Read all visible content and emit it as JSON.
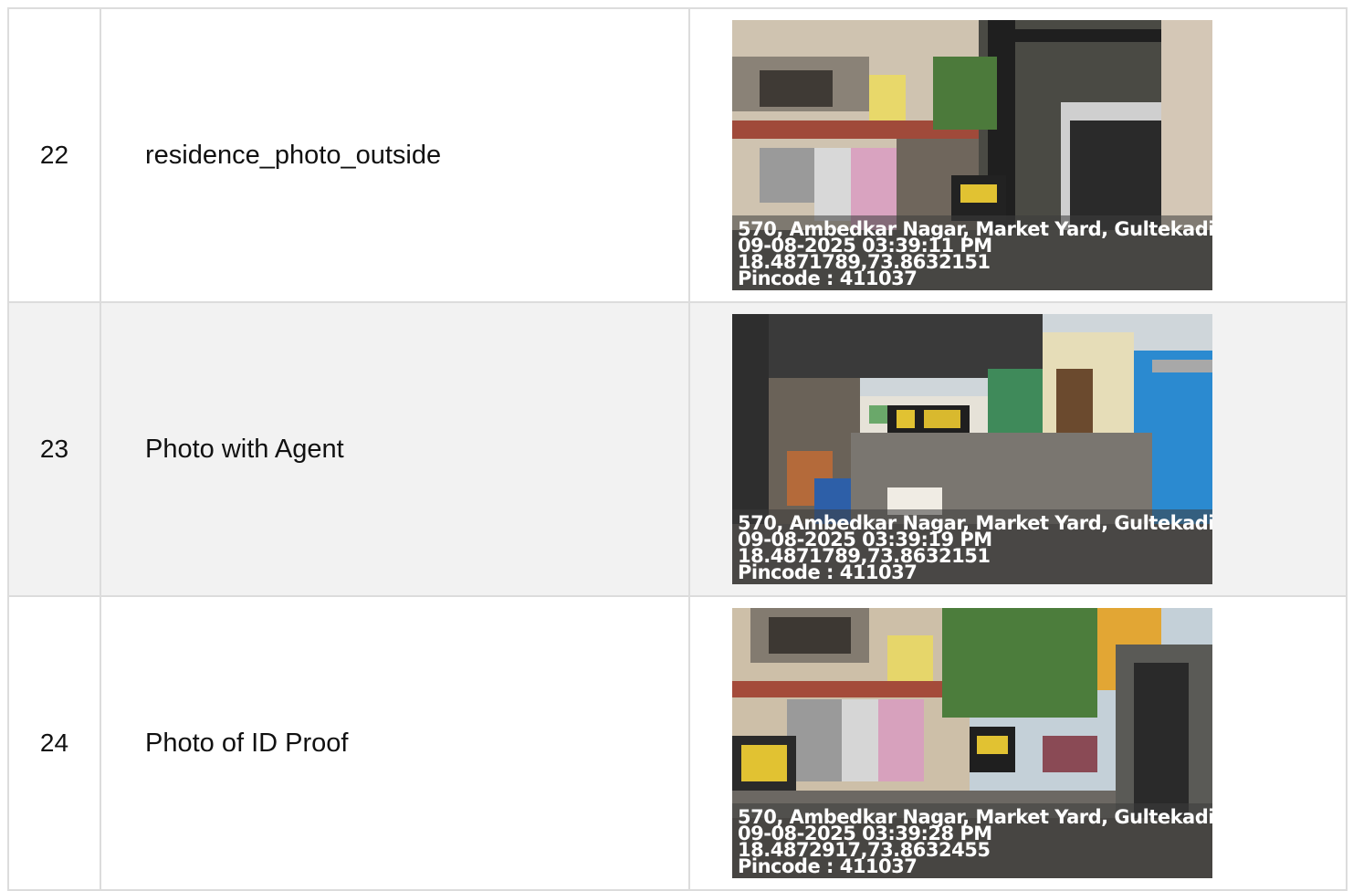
{
  "rows": [
    {
      "number": "22",
      "label": "residence_photo_outside",
      "photo": {
        "scene": "street-with-houses",
        "address": "570, Ambedkar Nagar, Market Yard, Gultekadi",
        "datetime": "09-08-2025 03:39:11 PM",
        "coords": "18.4871789,73.8632151",
        "pincode": "Pincode : 411037"
      }
    },
    {
      "number": "23",
      "label": "Photo with Agent",
      "photo": {
        "scene": "wet-lane-with-vehicles",
        "address": "570, Ambedkar Nagar, Market Yard, Gultekadi",
        "datetime": "09-08-2025 03:39:19 PM",
        "coords": "18.4871789,73.8632151",
        "pincode": "Pincode : 411037"
      }
    },
    {
      "number": "24",
      "label": "Photo of ID Proof",
      "photo": {
        "scene": "street-with-houses",
        "address": "570, Ambedkar Nagar, Market Yard, Gultekadi",
        "datetime": "09-08-2025 03:39:28 PM",
        "coords": "18.4872917,73.8632455",
        "pincode": "Pincode : 411037"
      }
    }
  ]
}
